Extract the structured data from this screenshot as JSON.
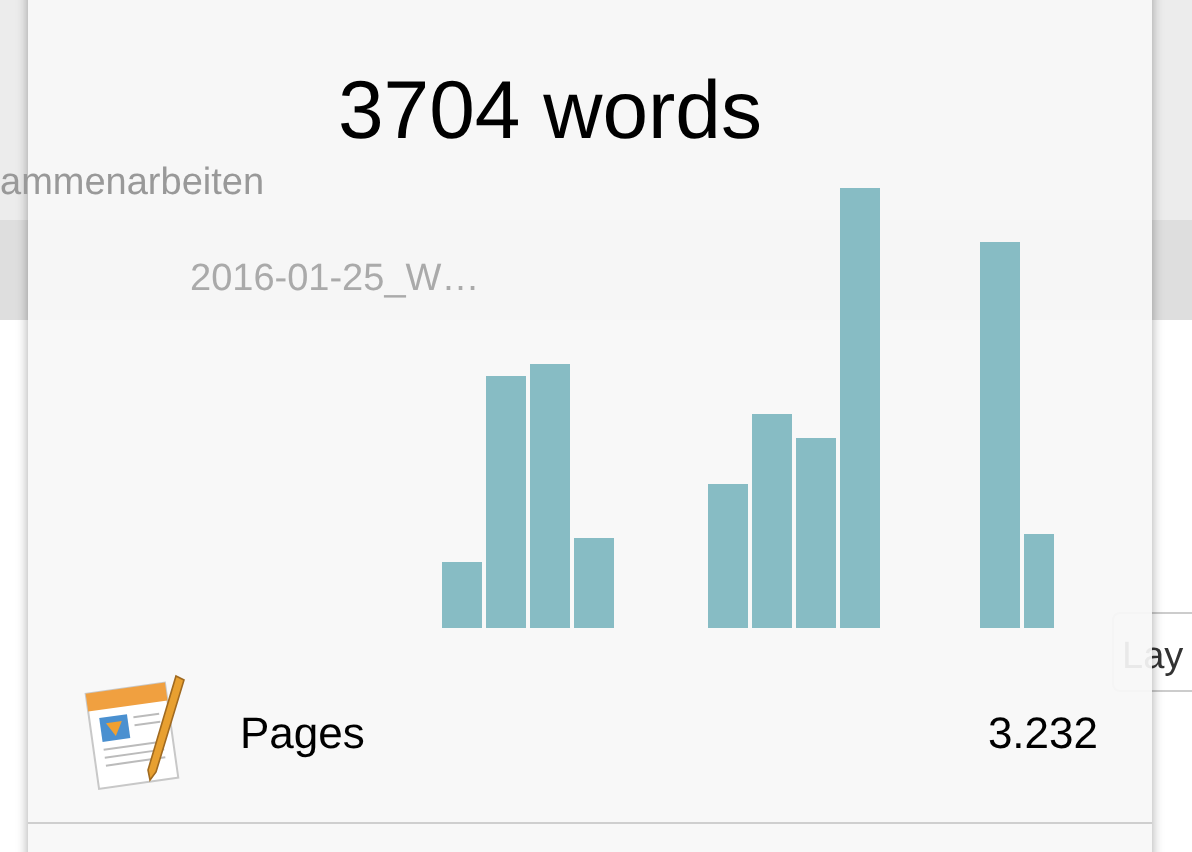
{
  "title": "3704 words",
  "app": {
    "name": "Pages",
    "count": "3.232"
  },
  "background": {
    "collaborate_label": "ammenarbeiten",
    "document_tab": "2016-01-25_W…",
    "inspector_tab": "Lay"
  }
}
